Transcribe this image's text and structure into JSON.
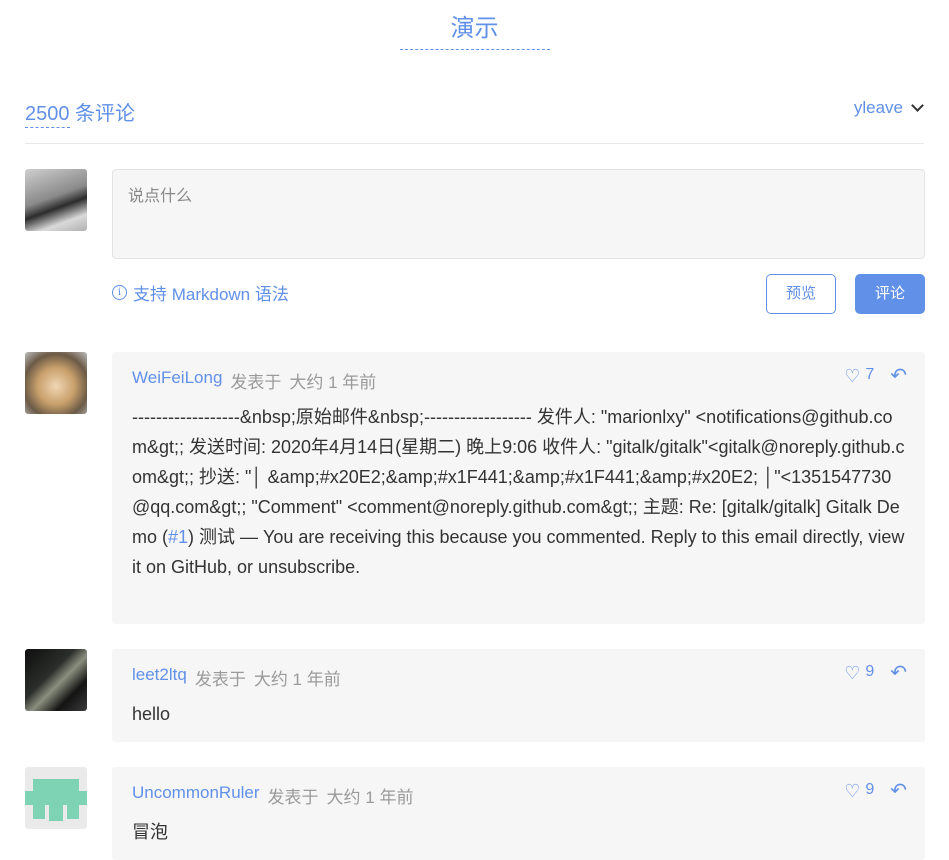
{
  "title": "演示",
  "meta": {
    "count": "2500",
    "count_suffix": " 条评论",
    "user": "yleave"
  },
  "editor": {
    "placeholder": "说点什么"
  },
  "markdown_tip": "支持 Markdown 语法",
  "buttons": {
    "preview": "预览",
    "submit": "评论"
  },
  "icons": {
    "info": "info-icon",
    "heart": "heart-icon",
    "reply": "reply-icon",
    "chevron": "chevron-down-icon"
  },
  "colors": {
    "accent": "#6190e8",
    "card_bg": "#f6f6f6",
    "muted": "#9a9a9a"
  },
  "comments": [
    {
      "author": "WeiFeiLong",
      "posted_label": "发表于",
      "time": "大约 1 年前",
      "likes": "7",
      "body_before_link": "------------------&nbsp;原始邮件&nbsp;------------------ 发件人: \"marionlxy\" <notifications@github.com&gt;; 发送时间: 2020年4月14日(星期二) 晚上9:06 收件人: \"gitalk/gitalk\"<gitalk@noreply.github.com&gt;; 抄送: \"│ &amp;#x20E2;&amp;#x1F441;&amp;#x1F441;&amp;#x20E2; │\"<1351547730@qq.com&gt;; \"Comment\" <comment@noreply.github.com&gt;; 主题: Re: [gitalk/gitalk] Gitalk Demo (",
      "link": "#1",
      "body_after_link": ") 测试 — You are receiving this because you commented. Reply to this email directly, view it on GitHub, or unsubscribe."
    },
    {
      "author": "leet2ltq",
      "posted_label": "发表于",
      "time": "大约 1 年前",
      "likes": "9",
      "body": "hello"
    },
    {
      "author": "UncommonRuler",
      "posted_label": "发表于",
      "time": "大约 1 年前",
      "likes": "9",
      "body": "冒泡"
    }
  ]
}
